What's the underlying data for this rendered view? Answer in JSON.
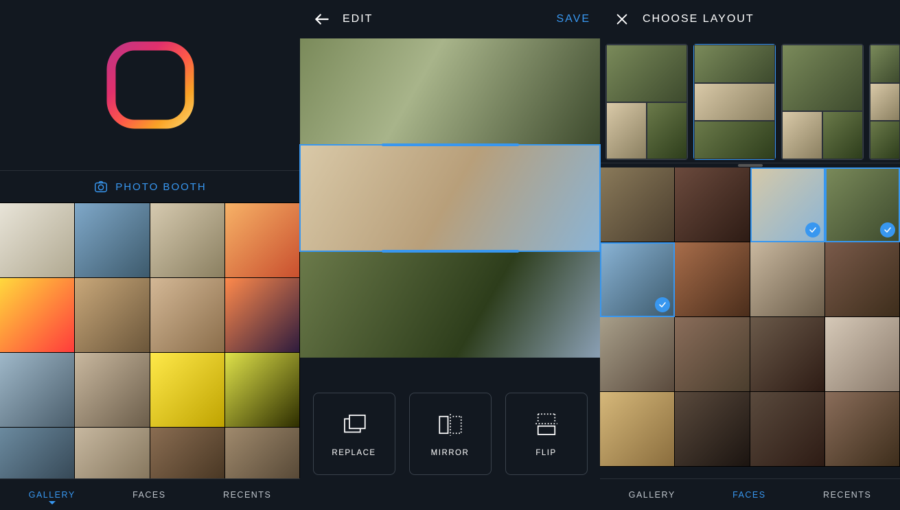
{
  "left": {
    "photo_booth_label": "PHOTO BOOTH",
    "tabs": {
      "gallery": "GALLERY",
      "faces": "FACES",
      "recents": "RECENTS"
    },
    "active_tab": "gallery"
  },
  "center": {
    "title": "EDIT",
    "save_label": "SAVE",
    "tools": {
      "replace": "REPLACE",
      "mirror": "MIRROR",
      "flip": "FLIP"
    },
    "selected_strip": 1
  },
  "right": {
    "title": "CHOOSE LAYOUT",
    "tabs": {
      "gallery": "GALLERY",
      "faces": "FACES",
      "recents": "RECENTS"
    },
    "active_tab": "faces",
    "selected_photo_indices": [
      2,
      3,
      4
    ]
  },
  "colors": {
    "accent": "#3897f0",
    "bg": "#121820"
  }
}
